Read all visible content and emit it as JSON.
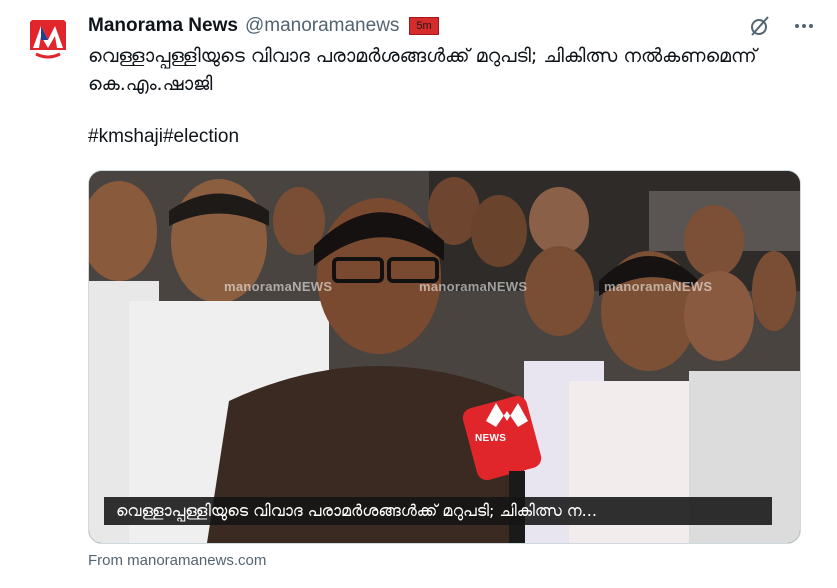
{
  "post": {
    "author_name": "Manorama News",
    "author_handle": "@manoramanews",
    "timestamp": "5m",
    "text": "വെള്ളാപ്പള്ളിയുടെ വിവാദ പരാമർശങ്ങൾക്ക് മറുപടി; ചികിത്സ നൽകണമെന്ന് കെ.എം.ഷാജി",
    "hashtags": "#kmshaji#election",
    "source": "From manoramanews.com"
  },
  "media": {
    "caption": "വെള്ളാപ്പള്ളിയുടെ വിവാദ പരാമർശങ്ങൾക്ക് മറുപടി; ചികിത്സ ന...",
    "watermark_1": "manoramaNEWS",
    "watermark_2": "manoramaNEWS",
    "watermark_3": "manoramaNEWS",
    "mic_label": "NEWS"
  },
  "icons": {
    "avatar": "manorama-news-logo",
    "grok": "grok-slash-icon",
    "more": "more-dots-icon"
  },
  "colors": {
    "brand_red": "#e0262b",
    "brand_blue": "#1c3f94",
    "text_primary": "#0f1419",
    "text_secondary": "#536471",
    "timestamp_highlight": "#d62b2b"
  }
}
